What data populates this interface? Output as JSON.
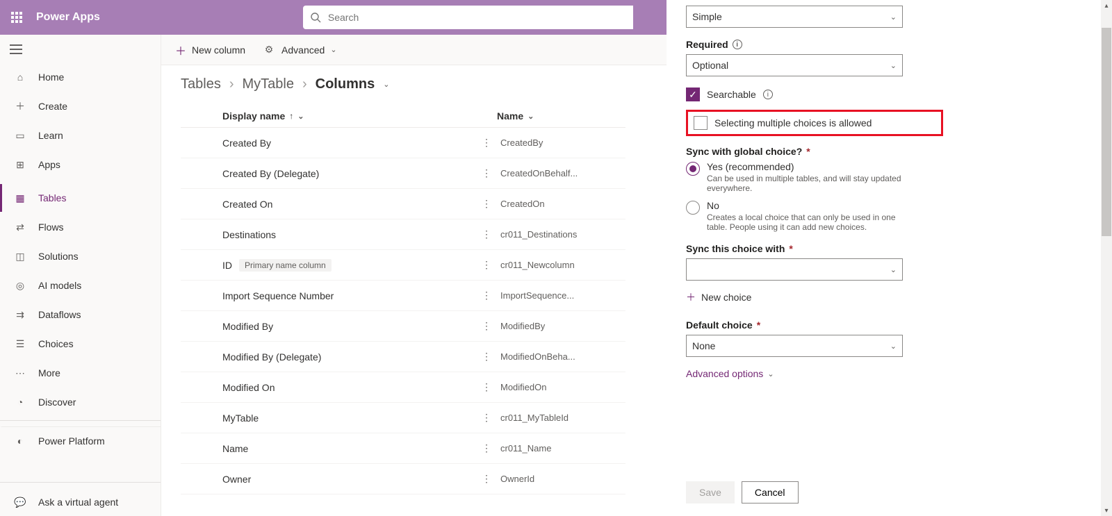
{
  "header": {
    "brand": "Power Apps",
    "search_placeholder": "Search"
  },
  "sidebar": {
    "items": [
      {
        "label": "Home",
        "icon": "home"
      },
      {
        "label": "Create",
        "icon": "plus"
      },
      {
        "label": "Learn",
        "icon": "book"
      },
      {
        "label": "Apps",
        "icon": "grid"
      },
      {
        "label": "Tables",
        "icon": "tables",
        "active": true
      },
      {
        "label": "Flows",
        "icon": "flow"
      },
      {
        "label": "Solutions",
        "icon": "solutions"
      },
      {
        "label": "AI models",
        "icon": "ai"
      },
      {
        "label": "Dataflows",
        "icon": "dataflow"
      },
      {
        "label": "Choices",
        "icon": "choices"
      },
      {
        "label": "More",
        "icon": "more"
      },
      {
        "label": "Discover",
        "icon": "discover"
      }
    ],
    "footer": {
      "label": "Power Platform"
    },
    "ask": "Ask a virtual agent"
  },
  "cmdbar": {
    "new_column": "New column",
    "advanced": "Advanced"
  },
  "breadcrumb": {
    "root": "Tables",
    "table": "MyTable",
    "current": "Columns"
  },
  "columns_table": {
    "headers": {
      "display": "Display name",
      "name": "Name"
    },
    "rows": [
      {
        "display": "Created By",
        "name": "CreatedBy"
      },
      {
        "display": "Created By (Delegate)",
        "name": "CreatedOnBehalf..."
      },
      {
        "display": "Created On",
        "name": "CreatedOn"
      },
      {
        "display": "Destinations",
        "name": "cr011_Destinations"
      },
      {
        "display": "ID",
        "badge": "Primary name column",
        "name": "cr011_Newcolumn"
      },
      {
        "display": "Import Sequence Number",
        "name": "ImportSequence..."
      },
      {
        "display": "Modified By",
        "name": "ModifiedBy"
      },
      {
        "display": "Modified By (Delegate)",
        "name": "ModifiedOnBeha..."
      },
      {
        "display": "Modified On",
        "name": "ModifiedOn"
      },
      {
        "display": "MyTable",
        "name": "cr011_MyTableId"
      },
      {
        "display": "Name",
        "name": "cr011_Name"
      },
      {
        "display": "Owner",
        "name": "OwnerId"
      }
    ]
  },
  "panel": {
    "behavior_value": "Simple",
    "required_label": "Required",
    "required_value": "Optional",
    "searchable_label": "Searchable",
    "multiple_label": "Selecting multiple choices is allowed",
    "sync_global_label": "Sync with global choice?",
    "radio_yes": "Yes (recommended)",
    "radio_yes_desc": "Can be used in multiple tables, and will stay updated everywhere.",
    "radio_no": "No",
    "radio_no_desc": "Creates a local choice that can only be used in one table. People using it can add new choices.",
    "sync_with_label": "Sync this choice with",
    "new_choice": "New choice",
    "default_choice_label": "Default choice",
    "default_choice_value": "None",
    "advanced_options": "Advanced options",
    "save": "Save",
    "cancel": "Cancel"
  }
}
